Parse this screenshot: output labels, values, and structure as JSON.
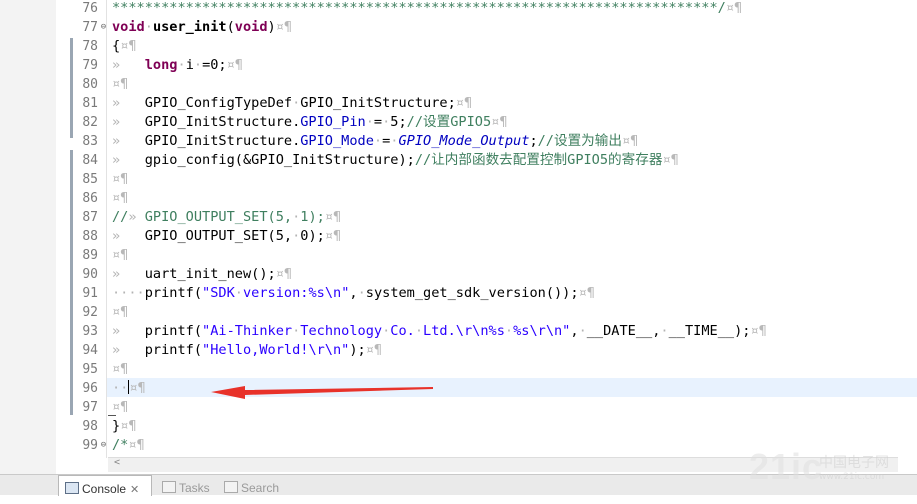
{
  "editor": {
    "lines": [
      {
        "n": "76",
        "text": "**************************************************************************/¤¶"
      },
      {
        "n": "77",
        "text": "void user_init(void)¤¶"
      },
      {
        "n": "78",
        "text": "{¤¶"
      },
      {
        "n": "79",
        "text": "long i =0;¤¶"
      },
      {
        "n": "80",
        "text": "¤¶"
      },
      {
        "n": "81",
        "text": "GPIO_ConfigTypeDef GPIO_InitStructure;¤¶"
      },
      {
        "n": "82",
        "text": "GPIO_InitStructure.GPIO_Pin = 5;//设置GPIO5¤¶"
      },
      {
        "n": "83",
        "text": "GPIO_InitStructure.GPIO_Mode = GPIO_Mode_Output;//设置为输出¤¶"
      },
      {
        "n": "84",
        "text": "gpio_config(&GPIO_InitStructure);//让内部函数去配置控制GPIO5的寄存器¤¶"
      },
      {
        "n": "85",
        "text": "¤¶"
      },
      {
        "n": "86",
        "text": "¤¶"
      },
      {
        "n": "87",
        "text": "//» GPIO_OUTPUT_SET(5, 1);¤¶"
      },
      {
        "n": "88",
        "text": "GPIO_OUTPUT_SET(5, 0);¤¶"
      },
      {
        "n": "89",
        "text": "¤¶"
      },
      {
        "n": "90",
        "text": "uart_init_new();¤¶"
      },
      {
        "n": "91",
        "text": "printf(\"SDK version:%s\\n\", system_get_sdk_version());¤¶"
      },
      {
        "n": "92",
        "text": "¤¶"
      },
      {
        "n": "93",
        "text": "printf(\"Ai-Thinker Technology Co. Ltd.\\r\\n%s %s\\r\\n\", __DATE__, __TIME__);¤¶"
      },
      {
        "n": "94",
        "text": "printf(\"Hello,World!\\r\\n\");¤¶"
      },
      {
        "n": "95",
        "text": "¤¶"
      },
      {
        "n": "96",
        "text": "¤¶"
      },
      {
        "n": "97",
        "text": "¤¶"
      },
      {
        "n": "98",
        "text": "}¤¶"
      },
      {
        "n": "99",
        "text": "/*¤¶"
      }
    ],
    "fold_symbol": "⊖"
  },
  "bottom_tabs": [
    {
      "label": "Console",
      "close": "✕"
    },
    {
      "label": "Tasks"
    },
    {
      "label": "Search"
    }
  ],
  "watermark": {
    "brand": "21ic",
    "cn": "中国电子网",
    "url": "www.21ic.com"
  },
  "colors": {
    "keyword": "#7f0055",
    "string": "#2a00ff",
    "comment": "#3f7f5f",
    "field": "#0000c0",
    "arrow": "#e8322a"
  }
}
